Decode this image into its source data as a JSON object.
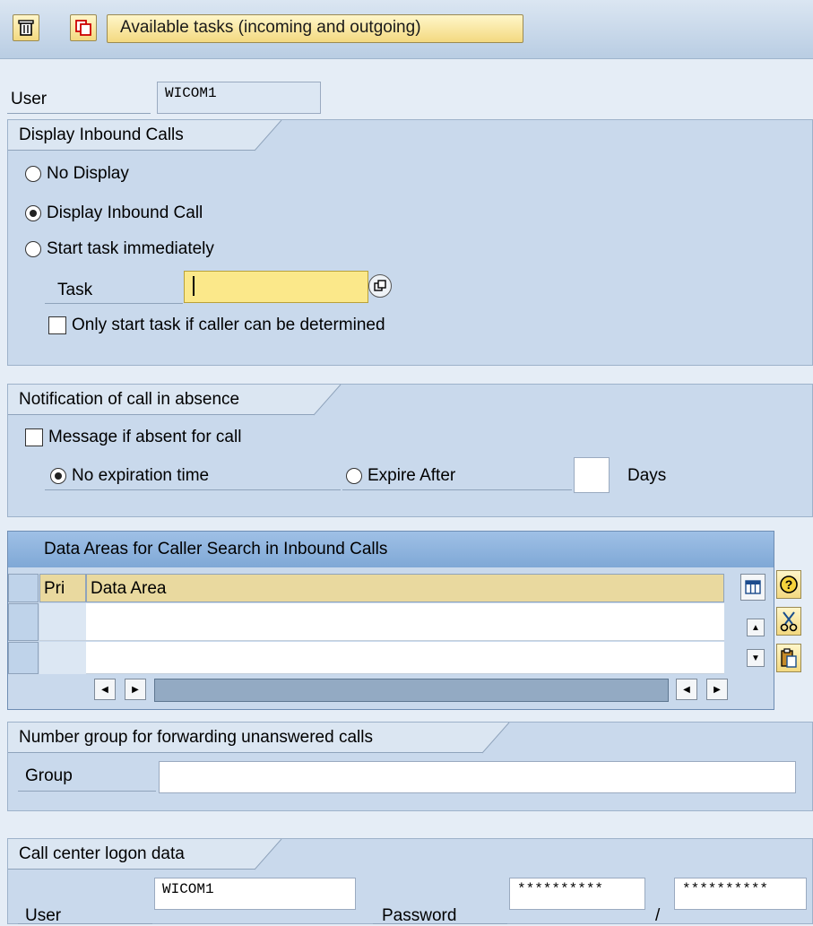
{
  "toolbar": {
    "delete_icon": "trash-icon",
    "copy_icon": "copy-icon",
    "tasks_button": "Available tasks (incoming and outgoing)"
  },
  "user": {
    "label": "User",
    "value": "WICOM1"
  },
  "inbound": {
    "title": "Display Inbound Calls",
    "options": [
      "No Display",
      "Display Inbound Call",
      "Start task immediately"
    ],
    "selected": "Display Inbound Call",
    "task_label": "Task",
    "task_value": "",
    "only_start_label": "Only start task if caller can be determined"
  },
  "absence": {
    "title": "Notification of call in absence",
    "message_label": "Message if absent for call",
    "no_expiration": "No expiration time",
    "expire_after": "Expire After",
    "days_value": "",
    "days_label": "Days"
  },
  "data_areas": {
    "title": "Data Areas for Caller Search in Inbound Calls",
    "col_pri": "Pri",
    "col_area": "Data Area"
  },
  "number_group": {
    "title": "Number group for forwarding unanswered calls",
    "group_label": "Group",
    "group_value": ""
  },
  "logon": {
    "title": "Call center logon data",
    "user_label": "User",
    "user_value": "WICOM1",
    "password_label": "Password",
    "password_value": "**********",
    "separator": "/",
    "password_confirm": "**********"
  },
  "colors": {
    "background": "#e5edf6",
    "group": "#c9d9ec",
    "highlight_input": "#fbe88a",
    "button": "#f3d980"
  }
}
